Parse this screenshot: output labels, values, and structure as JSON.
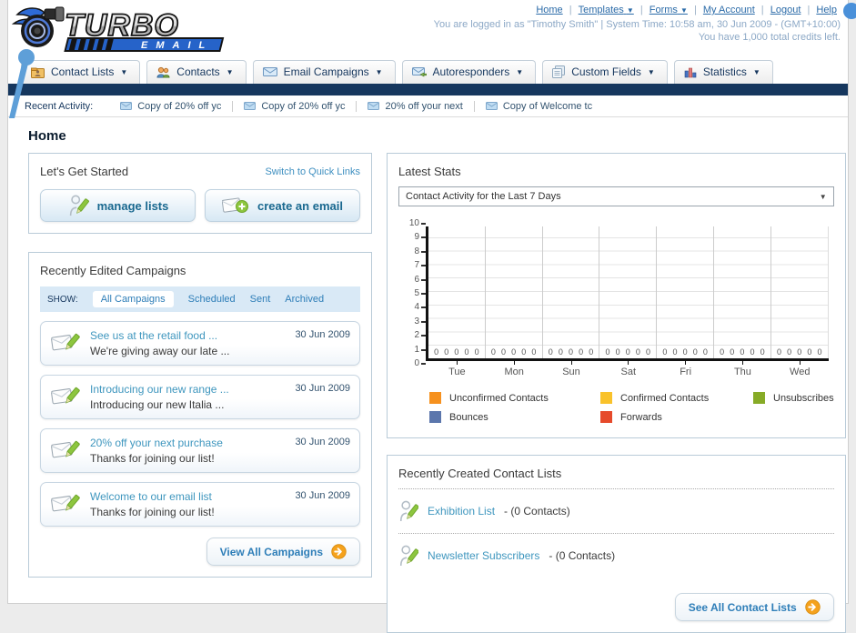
{
  "header": {
    "logo": {
      "title": "TURBO",
      "subtitle": "EMAIL"
    },
    "nav": [
      {
        "label": "Home"
      },
      {
        "label": "Templates",
        "dropdown": true
      },
      {
        "label": "Forms",
        "dropdown": true
      },
      {
        "label": "My Account"
      },
      {
        "label": "Logout"
      },
      {
        "label": "Help"
      }
    ],
    "login_line": "You are logged in as \"Timothy Smith\" | System Time: 10:58 am, 30 Jun 2009 - (GMT+10:00)",
    "credits_line": "You have 1,000 total credits left."
  },
  "tabs": [
    {
      "label": "Contact Lists",
      "icon": "contact-lists-icon"
    },
    {
      "label": "Contacts",
      "icon": "contacts-icon"
    },
    {
      "label": "Email Campaigns",
      "icon": "email-campaigns-icon"
    },
    {
      "label": "Autoresponders",
      "icon": "autoresponders-icon"
    },
    {
      "label": "Custom Fields",
      "icon": "custom-fields-icon"
    },
    {
      "label": "Statistics",
      "icon": "statistics-icon"
    }
  ],
  "recent": {
    "label": "Recent Activity:",
    "items": [
      "Copy of 20% off yc",
      "Copy of 20% off yc",
      "20% off your next ",
      "Copy of Welcome tc"
    ]
  },
  "page_title": "Home",
  "get_started": {
    "title": "Let's Get Started",
    "switch_label": "Switch to Quick Links",
    "manage_label": "manage lists",
    "create_label": "create an email"
  },
  "campaigns": {
    "title": "Recently Edited Campaigns",
    "show_label": "SHOW:",
    "filters": [
      "All Campaigns",
      "Scheduled",
      "Sent",
      "Archived"
    ],
    "active_filter": "All Campaigns",
    "items": [
      {
        "title": "See us at the retail food ...",
        "subtitle": "We're giving away our late ...",
        "date": "30 Jun 2009"
      },
      {
        "title": "Introducing our new range ...",
        "subtitle": "Introducing our new Italia ...",
        "date": "30 Jun 2009"
      },
      {
        "title": "20% off your next purchase",
        "subtitle": "Thanks for joining our list!",
        "date": "30 Jun 2009"
      },
      {
        "title": "Welcome to our email list",
        "subtitle": "Thanks for joining our list!",
        "date": "30 Jun 2009"
      }
    ],
    "view_all_label": "View All Campaigns"
  },
  "stats": {
    "title": "Latest Stats",
    "dropdown_value": "Contact Activity for the Last 7 Days"
  },
  "chart_data": {
    "type": "bar",
    "title": "Contact Activity for the Last 7 Days",
    "categories": [
      "Tue",
      "Mon",
      "Sun",
      "Sat",
      "Fri",
      "Thu",
      "Wed"
    ],
    "series": [
      {
        "name": "Unconfirmed Contacts",
        "color": "#F6911E",
        "values": [
          0,
          0,
          0,
          0,
          0,
          0,
          0
        ]
      },
      {
        "name": "Confirmed Contacts",
        "color": "#F9C22B",
        "values": [
          0,
          0,
          0,
          0,
          0,
          0,
          0
        ]
      },
      {
        "name": "Unsubscribes",
        "color": "#87AB27",
        "values": [
          0,
          0,
          0,
          0,
          0,
          0,
          0
        ]
      },
      {
        "name": "Bounces",
        "color": "#5B76AC",
        "values": [
          0,
          0,
          0,
          0,
          0,
          0,
          0
        ]
      },
      {
        "name": "Forwards",
        "color": "#E64A2B",
        "values": [
          0,
          0,
          0,
          0,
          0,
          0,
          0
        ]
      }
    ],
    "ylim": [
      0,
      10
    ],
    "yticks": [
      0,
      1,
      2,
      3,
      4,
      5,
      6,
      7,
      8,
      9,
      10
    ],
    "grid": true,
    "legend_position": "bottom"
  },
  "lists": {
    "title": "Recently Created Contact Lists",
    "items": [
      {
        "name": "Exhibition List",
        "count": "- (0 Contacts)"
      },
      {
        "name": "Newsletter Subscribers",
        "count": "- (0 Contacts)"
      }
    ],
    "see_all_label": "See All Contact Lists"
  }
}
